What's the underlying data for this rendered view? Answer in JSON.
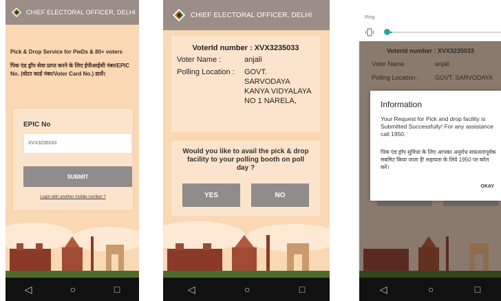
{
  "app": {
    "title": "CHIEF ELECTORAL OFFICER, DELHI"
  },
  "screen1": {
    "service_heading": "Pick & Drop Service for PwDs & 80+ voters",
    "hindi_instruction": "पिक एंड ड्रॉप सेवा प्राप्त करने के लिए ईपीआईसी नंबर/EPIC No. (वोटर कार्ड नंबर/Voter Card No.) डालें।",
    "epic_label": "EPIC No",
    "epic_value": "XVX3235033",
    "submit_label": "SUBMIT",
    "login_link": "Login with another mobile number ?"
  },
  "screen2": {
    "voterid_line": "VoterId number : XVX3235033",
    "voter_name_label": "Voter Name :",
    "voter_name_value": "anjali",
    "polling_label": "Polling Location :",
    "polling_value": "GOVT. SARVODAYA KANYA VIDYALAYA NO 1 NARELA,",
    "question": "Would you like to avail the pick & drop facility to your polling booth on poll day ?",
    "yes_label": "YES",
    "no_label": "NO"
  },
  "screen3": {
    "ring_label": "Ring",
    "volume_level": 0.05,
    "bg_voterid_line": "Voterid number : XVX3235033",
    "bg_voter_name_label": "Voter Name",
    "bg_voter_name_value": "anjali",
    "bg_polling_label": "Polling Location :",
    "bg_polling_value": "GOVT. SARVODAYA",
    "dialog_title": "Information",
    "dialog_message": "Your Request for Pick and drop facility is Submitted Successfully! For any assistance call 1950.",
    "dialog_hindi": "पिक एंड ड्रॉप सुविधा के लिए आपका अनुरोध सफलतापूर्वक सबमिट किया जाता है! सहायता के लिये 1950 पर कॉल करें।",
    "ok_label": "OKAY"
  },
  "nav": {
    "back": "◁",
    "home": "○",
    "recent": "□"
  },
  "colors": {
    "background": "#fad8b4",
    "card": "#fbe4cb",
    "topbar": "#9a8e86",
    "button": "#8f8c8b",
    "accent": "#26a69a"
  }
}
